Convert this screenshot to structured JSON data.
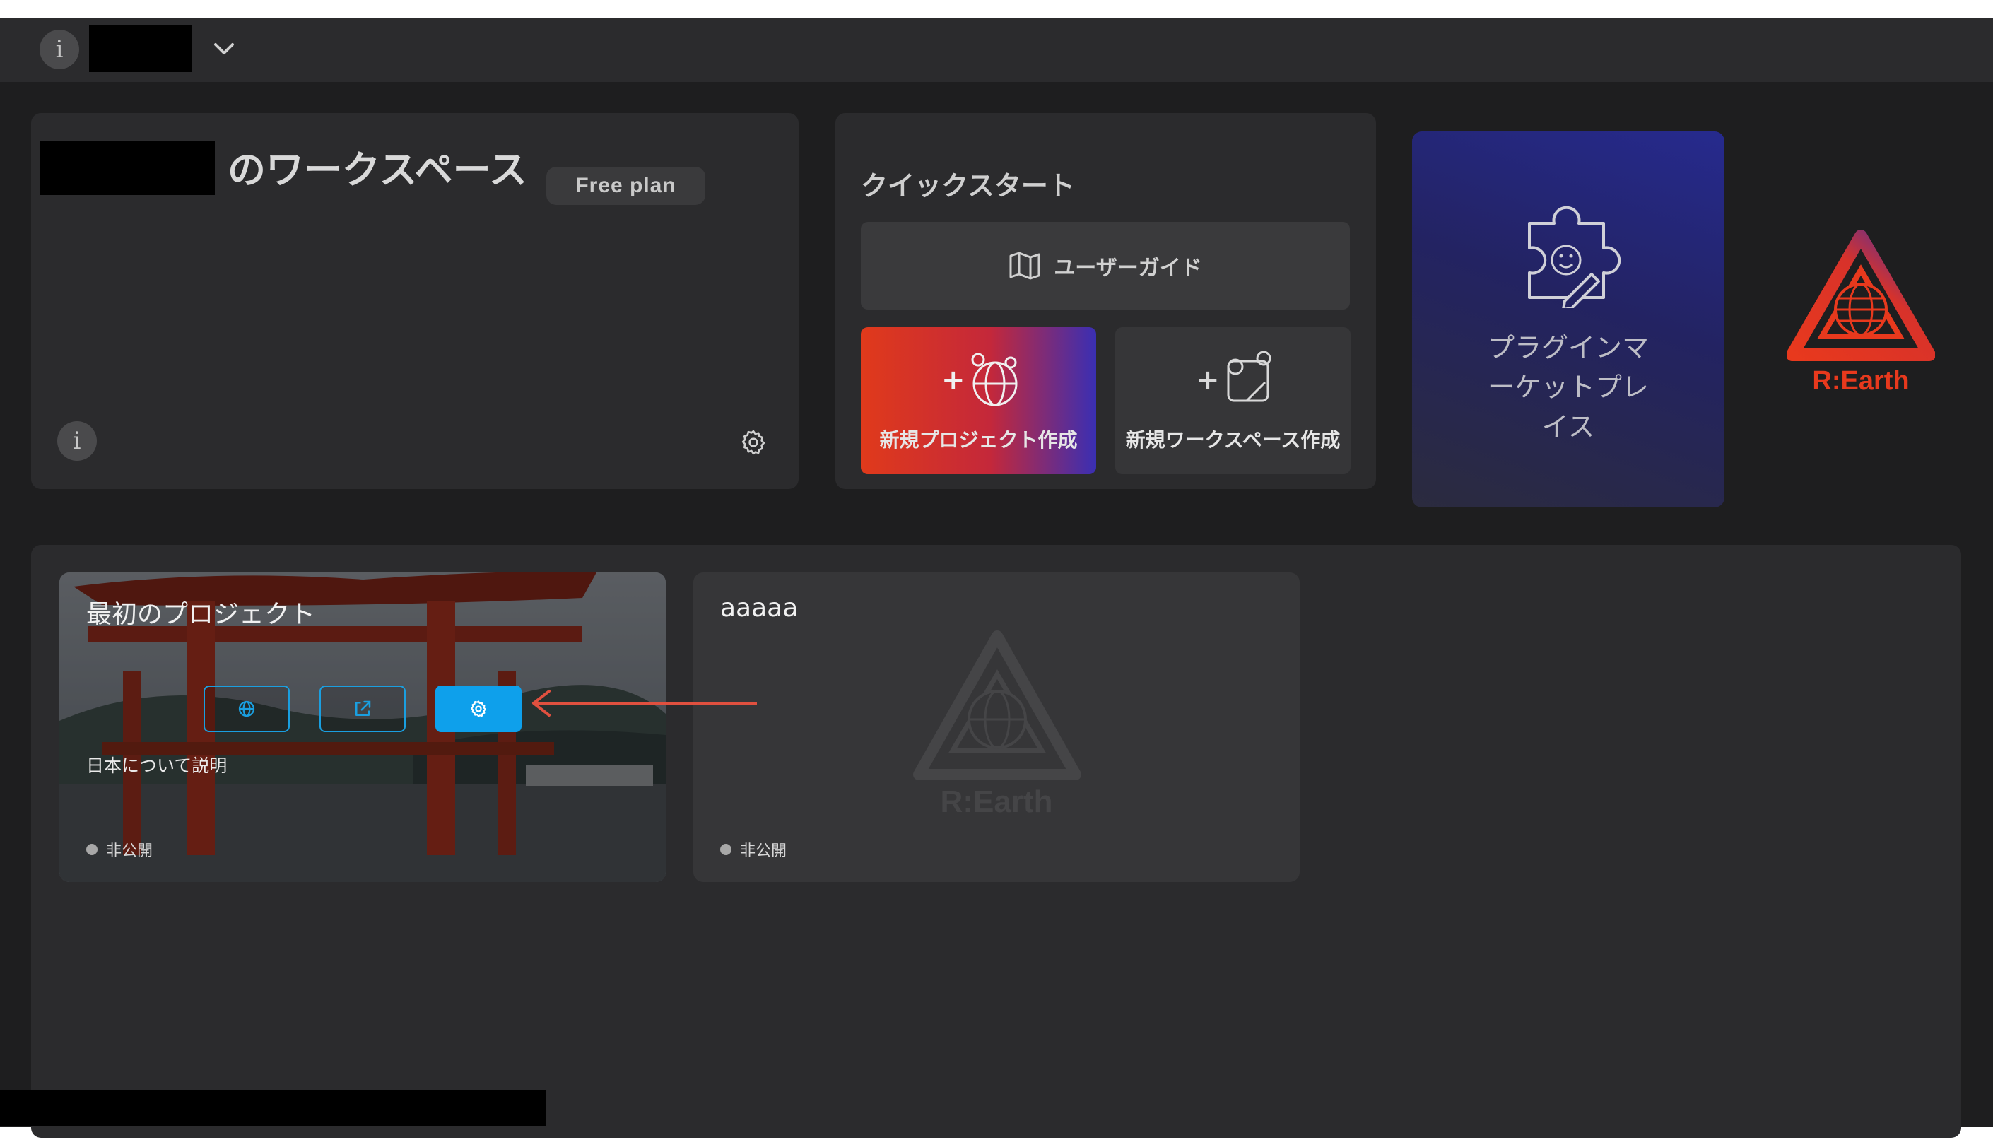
{
  "workspace": {
    "title_suffix": "のワークスペース",
    "plan": "Free plan"
  },
  "quickstart": {
    "title": "クイックスタート",
    "user_guide": "ユーザーガイド",
    "new_project": "新規プロジェクト作成",
    "new_workspace": "新規ワークスペース作成"
  },
  "marketplace": {
    "label_line1": "プラグインマ",
    "label_line2": "ーケットプレ",
    "label_line3": "イス"
  },
  "brand": {
    "name": "R:Earth"
  },
  "projects": [
    {
      "title": "最初のプロジェクト",
      "description": "日本について説明",
      "status": "非公開"
    },
    {
      "title": "aaaaa",
      "status": "非公開",
      "placeholder_brand": "R:Earth"
    }
  ],
  "colors": {
    "accent": "#0ea0eb",
    "brand_red": "#e8391d",
    "annotation_arrow": "#e0503f"
  }
}
